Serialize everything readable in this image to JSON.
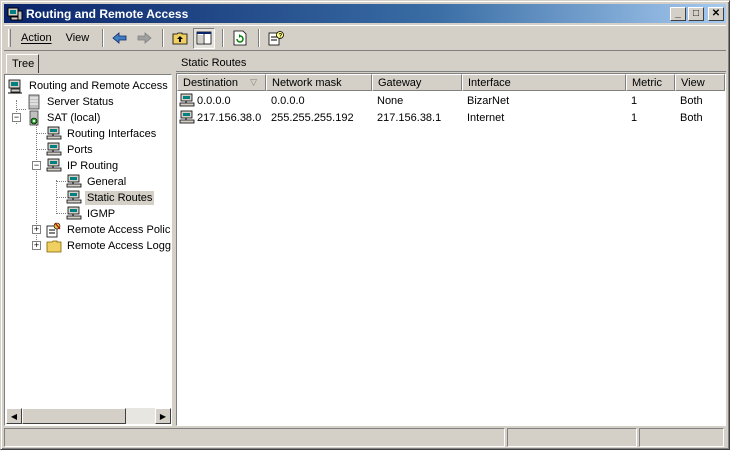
{
  "window": {
    "title": "Routing and Remote Access",
    "controls": {
      "minimize": "_",
      "maximize": "□",
      "close": "✕"
    }
  },
  "menubar": {
    "items": [
      {
        "label": "Action",
        "accel": "A"
      },
      {
        "label": "View",
        "accel": "V"
      }
    ],
    "toolbar": [
      "back-icon",
      "forward-icon",
      "up-folder-icon",
      "show-hide-tree-icon",
      "refresh-icon",
      "properties-help-icon"
    ]
  },
  "tree": {
    "tab_label": "Tree",
    "nodes": [
      {
        "label": "Routing and Remote Access",
        "icon": "server-computer-icon"
      },
      {
        "label": "Server Status",
        "icon": "server-status-icon"
      },
      {
        "label": "SAT (local)",
        "icon": "local-server-icon",
        "expander": "−"
      },
      {
        "label": "Routing Interfaces",
        "icon": "network-icon"
      },
      {
        "label": "Ports",
        "icon": "network-icon"
      },
      {
        "label": "IP Routing",
        "icon": "network-icon",
        "expander": "−"
      },
      {
        "label": "General",
        "icon": "network-icon"
      },
      {
        "label": "Static Routes",
        "icon": "network-icon",
        "selected": true
      },
      {
        "label": "IGMP",
        "icon": "network-icon"
      },
      {
        "label": "Remote Access Policies",
        "icon": "policy-icon",
        "expander": "+"
      },
      {
        "label": "Remote Access Logging",
        "icon": "folder-icon",
        "expander": "+"
      }
    ],
    "scroll": {
      "left": "◀",
      "right": "▶"
    }
  },
  "details": {
    "header": "Static Routes",
    "columns": [
      "Destination",
      "Network mask",
      "Gateway",
      "Interface",
      "Metric",
      "View"
    ],
    "sort_indicator": "▽",
    "rows": [
      {
        "destination": "0.0.0.0",
        "mask": "0.0.0.0",
        "gateway": "None",
        "interface": "BizarNet",
        "metric": "1",
        "view": "Both"
      },
      {
        "destination": "217.156.38.0",
        "mask": "255.255.255.192",
        "gateway": "217.156.38.1",
        "interface": "Internet",
        "metric": "1",
        "view": "Both"
      }
    ]
  }
}
